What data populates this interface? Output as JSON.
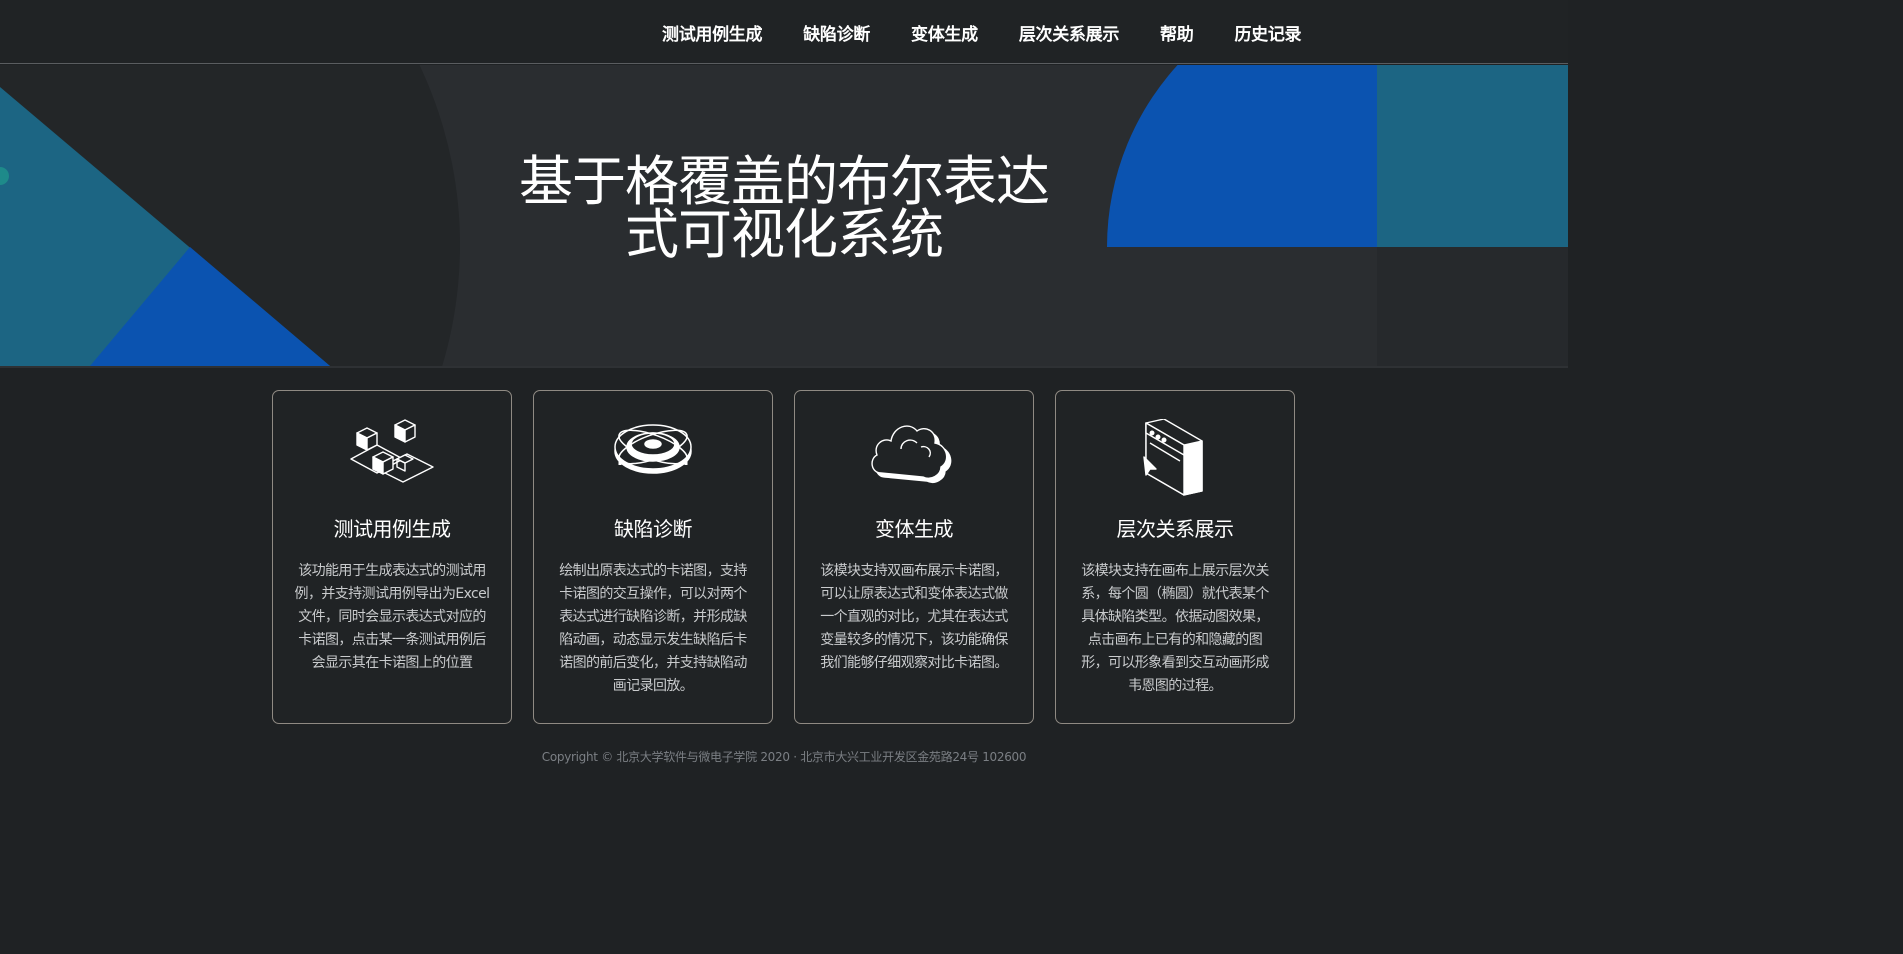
{
  "nav": {
    "items": [
      "测试用例生成",
      "缺陷诊断",
      "变体生成",
      "层次关系展示",
      "帮助",
      "历史记录"
    ]
  },
  "hero": {
    "title_line1": "基于格覆盖的布尔表达",
    "title_line2": "式可视化系统"
  },
  "cards": [
    {
      "icon": "cubes-icon",
      "title": "测试用例生成",
      "description": "该功能用于生成表达式的测试用例，并支持测试用例导出为Excel文件，同时会显示表达式对应的卡诺图，点击某一条测试用例后会显示其在卡诺图上的位置"
    },
    {
      "icon": "atom-disc-icon",
      "title": "缺陷诊断",
      "description": "绘制出原表达式的卡诺图，支持卡诺图的交互操作，可以对两个表达式进行缺陷诊断，并形成缺陷动画，动态显示发生缺陷后卡诺图的前后变化，并支持缺陷动画记录回放。"
    },
    {
      "icon": "cloud-icon",
      "title": "变体生成",
      "description": "该模块支持双画布展示卡诺图，可以让原表达式和变体表达式做一个直观的对比，尤其在表达式变量较多的情况下，该功能确保我们能够仔细观察对比卡诺图。"
    },
    {
      "icon": "browser-window-icon",
      "title": "层次关系展示",
      "description": "该模块支持在画布上展示层次关系，每个圆（椭圆）就代表某个具体缺陷类型。依据动图效果，点击画布上已有的和隐藏的图形，可以形象看到交互动画形成韦恩图的过程。"
    }
  ],
  "footer": {
    "text": "Copyright © 北京大学软件与微电子学院 2020 · 北京市大兴工业开发区金苑路24号 102600"
  },
  "colors": {
    "background": "#1f2224",
    "hero_background": "#2a2d30",
    "teal": "#1c6583",
    "blue": "#0b53b0",
    "card_border": "#8f8a83"
  }
}
